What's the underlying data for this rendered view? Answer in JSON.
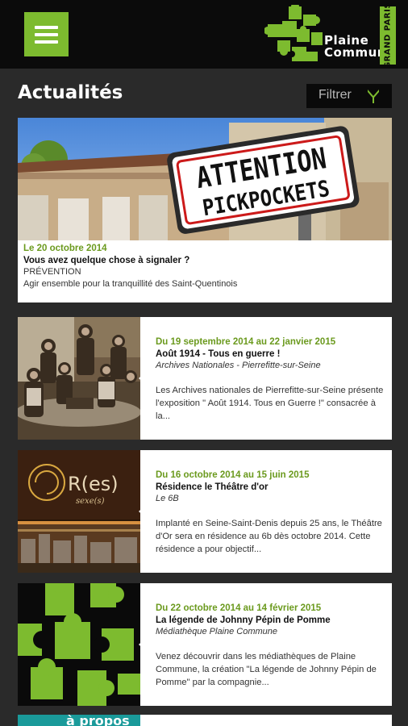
{
  "app": {
    "logo": {
      "line1": "Plaine",
      "line2": "Commune",
      "vertical": "GRAND PARIS"
    }
  },
  "header": {
    "title": "Actualités",
    "filter_label": "Filtrer"
  },
  "colors": {
    "accent": "#7dbb2f",
    "date_green": "#6b9a1e",
    "topbar": "#0b0b0b",
    "background": "#2a2a2a"
  },
  "icons": {
    "menu": "hamburger-menu-icon",
    "filter": "funnel-icon"
  },
  "featured": {
    "image": "attention-pickpockets-sign",
    "sign_line1": "ATTENTION",
    "sign_line2": "PICKPOCKETS",
    "date": "Le 20 octobre 2014",
    "headline": "Vous avez quelque chose à signaler ?",
    "category": "PRÉVENTION",
    "summary": "Agir ensemble pour la tranquillité des Saint-Quentinois"
  },
  "articles": [
    {
      "image": "vintage-school-photo",
      "date": "Du 19 septembre 2014 au 22 janvier 2015",
      "headline": "Août 1914 - Tous en guerre !",
      "location": "Archives Nationales - Pierrefitte-sur-Seine",
      "summary": "Les Archives nationales de Pierrefitte-sur-Seine présente l'exposition \" Août 1914. Tous en Guerre !\" consacrée à la..."
    },
    {
      "image": "residence-theatre-dor-poster",
      "poster_title": "R(es)",
      "poster_sub": "sexe(s)",
      "date": "Du 16 octobre 2014 au 15 juin 2015",
      "headline": "Résidence le Théâtre d'or",
      "location": "Le 6B",
      "summary": "Implanté en Seine-Saint-Denis depuis 25 ans, le Théâtre d'Or sera en résidence au 6b dès octobre 2014. Cette résidence a pour objectif..."
    },
    {
      "image": "green-puzzle-pieces",
      "date": "Du 22 octobre 2014 au 14 février 2015",
      "headline": "La légende de Johnny Pépin de Pomme",
      "location": "Médiathèque Plaine Commune",
      "summary": "Venez découvrir dans les médiathèques de Plaine Commune, la création \"La légende de Johnny Pépin de Pomme\" par la compagnie..."
    }
  ],
  "peek": {
    "image": "a-propos-teal-banner",
    "text": "à propos"
  }
}
